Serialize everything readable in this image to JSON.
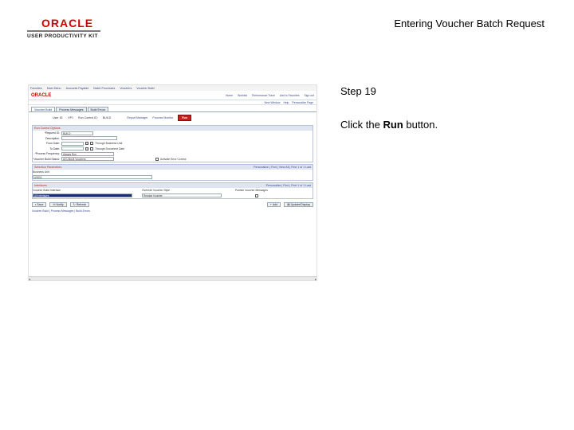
{
  "brand": {
    "name": "ORACLE",
    "product": "USER PRODUCTIVITY KIT"
  },
  "doc": {
    "title": "Entering Voucher Batch Request"
  },
  "step": {
    "label": "Step 19",
    "instruction_pre": "Click the ",
    "instruction_bold": "Run",
    "instruction_post": " button."
  },
  "app": {
    "topnav": [
      "Favorites",
      "Main Menu",
      "Accounts Payable",
      "Batch Processes",
      "Vouchers",
      "Voucher Build"
    ],
    "header_links": [
      "Home",
      "Worklist",
      "Performance Trace",
      "Add to Favorites",
      "Sign out"
    ],
    "subheader": [
      "New Window",
      "Help",
      "Personalize Page"
    ],
    "tabs": [
      "Voucher Build",
      "Process Messages",
      "Build Errors"
    ],
    "ids": {
      "user_label": "User ID:",
      "user_value": "VP1",
      "run_control_label": "Run Control ID:",
      "run_control_value": "BUILD",
      "report_manager": "Report Manager",
      "process_monitor": "Process Monitor",
      "run_label": "Run"
    },
    "run_control_options": {
      "title": "Run Control Options",
      "request_id_label": "*Request ID:",
      "request_id_value": "BUILD",
      "description_label": "Description:",
      "from_date_label": "From Date:",
      "from_date_check": "Through Business Unit",
      "to_date_label": "To Date:",
      "to_date_check": "Through Document Date",
      "process_frequency_label": "*Process Frequency:",
      "process_frequency_value": "Always Run",
      "voucher_status_label": "*Voucher Build Status:",
      "voucher_status_value": "All Unbuilt Vouchers",
      "activate_check": "Activate Error Control"
    },
    "selection": {
      "title": "Selection Parameters",
      "nav": "Personalize | Find | View All | First 1 of 1 Last",
      "business_unit_label": "Business Unit",
      "business_unit_value": "US001"
    },
    "interfaces": {
      "title": "Interfaces",
      "nav": "Personalize | Find | First 1 of 1 Last",
      "col1": "Voucher Build Interface",
      "col2": "Override Voucher Style",
      "col3": "Publish Voucher Messages",
      "row_value": "All Interfaces",
      "style_value": "Regular Voucher"
    },
    "buttons": {
      "save": "Save",
      "notify": "Notify",
      "refresh": "Refresh",
      "add": "Add",
      "update": "Update/Display"
    },
    "footer_links": "Voucher Build | Process Messages | Build Errors"
  }
}
